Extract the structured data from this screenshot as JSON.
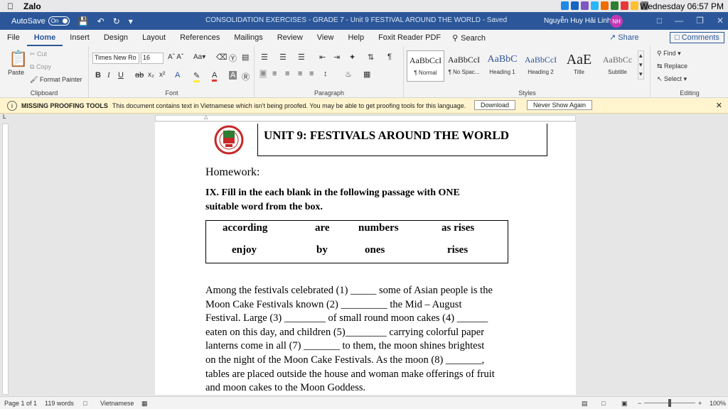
{
  "os_bar": {
    "app_name": "Zalo",
    "clock": "Wednesday 06:57 PM"
  },
  "titlebar": {
    "autosave_label": "AutoSave",
    "autosave_state": "On",
    "doc_title": "CONSOLIDATION EXERCISES - GRADE 7 - Unit 9 FESTIVAL AROUND THE WORLD  -  Saved",
    "user_name": "Nguyễn Huy Hải Linh",
    "user_initials": "NH"
  },
  "tabs": [
    "File",
    "Home",
    "Insert",
    "Design",
    "Layout",
    "References",
    "Mailings",
    "Review",
    "View",
    "Help",
    "Foxit Reader PDF"
  ],
  "active_tab": "Home",
  "search_label": "Search",
  "share_label": "Share",
  "comments_label": "Comments",
  "ribbon": {
    "clipboard": {
      "paste": "Paste",
      "cut": "Cut",
      "copy": "Copy",
      "format_painter": "Format Painter",
      "label": "Clipboard"
    },
    "font": {
      "name": "Times New Ro",
      "size": "16",
      "label": "Font"
    },
    "paragraph": {
      "label": "Paragraph"
    },
    "styles": {
      "label": "Styles",
      "items": [
        {
          "sample": "AaBbCcI",
          "name": "¶ Normal"
        },
        {
          "sample": "AaBbCcI",
          "name": "¶ No Spac..."
        },
        {
          "sample": "AaBbC",
          "name": "Heading 1"
        },
        {
          "sample": "AaBbCcI",
          "name": "Heading 2"
        },
        {
          "sample": "AaE",
          "name": "Title"
        },
        {
          "sample": "AaBbCc",
          "name": "Subtitle"
        }
      ]
    },
    "editing": {
      "find": "Find",
      "replace": "Replace",
      "select": "Select",
      "label": "Editing"
    }
  },
  "notice": {
    "title": "MISSING PROOFING TOOLS",
    "message": "This document contains text in Vietnamese which isn't being proofed. You may be able to get proofing tools for this language.",
    "download": "Download",
    "never_show": "Never Show Again"
  },
  "document": {
    "unit_title": "UNIT 9: FESTIVALS AROUND THE WORLD",
    "homework": "Homework:",
    "instruction_line1": "IX. Fill in the each blank in the following passage with ONE",
    "instruction_line2": "suitable word from the box.",
    "words_row1": [
      "according",
      "are",
      "numbers",
      "as rises"
    ],
    "words_row2": [
      "enjoy",
      "by",
      "ones",
      "rises"
    ],
    "passage_lines": [
      "Among the festivals celebrated (1) _____ some of Asian people is the",
      "Moon Cake Festivals known (2) _________ the Mid – August",
      "Festival. Large (3) ________ of small round moon cakes (4) ______",
      "eaten on this day, and children (5)________ carrying colorful paper",
      "lanterns come in all (7) _______ to them, the moon shines brightest",
      "on the night of the Moon Cake Festivals. As the moon (8) _______,",
      "tables are placed outside the house and woman make offerings of fruit",
      "and moon cakes to the Moon Goddess."
    ]
  },
  "status": {
    "page": "Page 1 of 1",
    "words": "119 words",
    "language": "Vietnamese",
    "zoom": "100%",
    "zoom_percent": 100
  }
}
